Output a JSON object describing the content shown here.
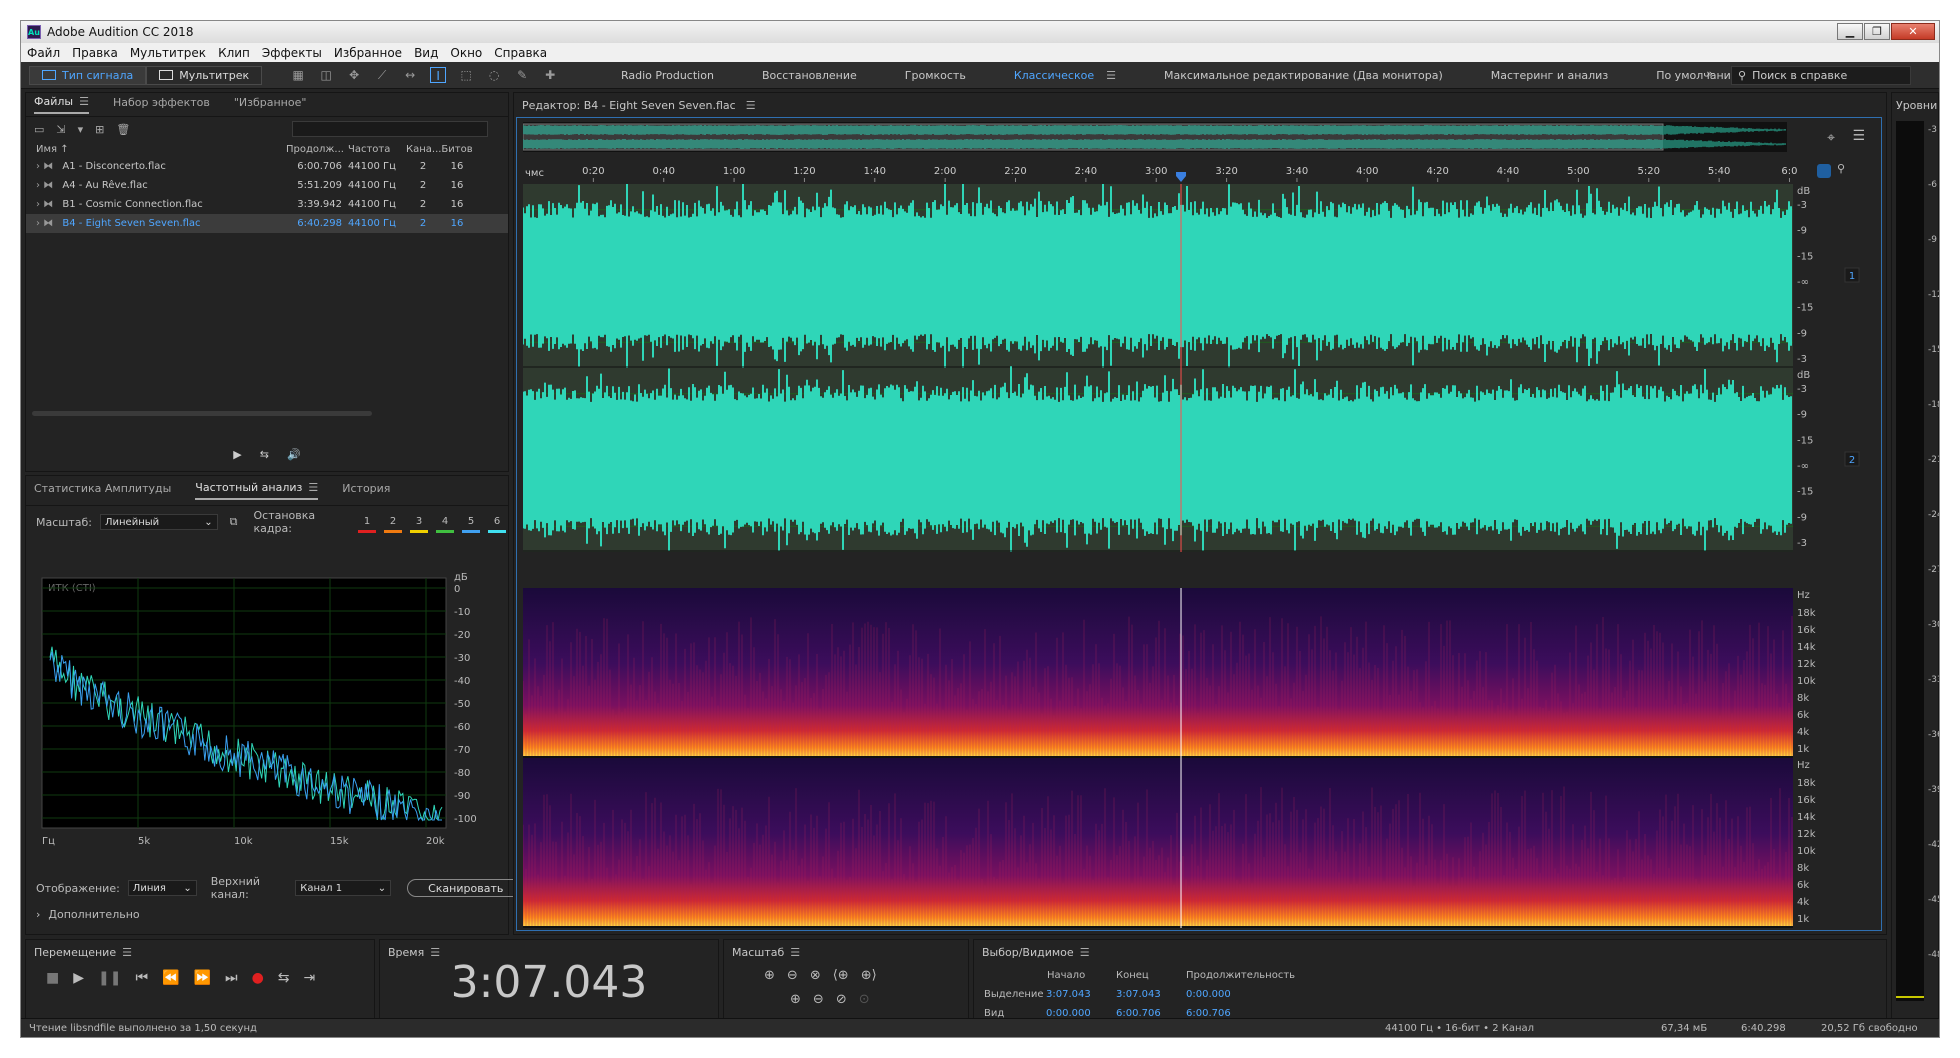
{
  "window": {
    "title": "Adobe Audition CC 2018",
    "app_icon": "Au"
  },
  "menu": [
    "Файл",
    "Правка",
    "Мультитрек",
    "Клип",
    "Эффекты",
    "Избранное",
    "Вид",
    "Окно",
    "Справка"
  ],
  "toolbar": {
    "mode_waveform": "Тип сигнала",
    "mode_multitrack": "Мультитрек",
    "workspaces": [
      "Radio Production",
      "Восстановление",
      "Громкость",
      "Классическое",
      "Максимальное редактирование (Два монитора)",
      "Мастеринг и анализ",
      "По умолчанию"
    ],
    "active_workspace": "Классическое",
    "help_search": "Поиск в справке"
  },
  "files_panel": {
    "tabs": [
      "Файлы",
      "Набор эффектов",
      "\"Избранное\""
    ],
    "columns": [
      "Имя",
      "Продолж...",
      "Частота",
      "Кана...",
      "Битов"
    ],
    "rows": [
      {
        "name": "A1 - Disconcerto.flac",
        "duration": "6:00.706",
        "rate": "44100 Гц",
        "channels": "2",
        "bits": "16",
        "selected": false
      },
      {
        "name": "A4 - Au Rêve.flac",
        "duration": "5:51.209",
        "rate": "44100 Гц",
        "channels": "2",
        "bits": "16",
        "selected": false
      },
      {
        "name": "B1 - Cosmic Connection.flac",
        "duration": "3:39.942",
        "rate": "44100 Гц",
        "channels": "2",
        "bits": "16",
        "selected": false
      },
      {
        "name": "B4 - Eight Seven Seven.flac",
        "duration": "6:40.298",
        "rate": "44100 Гц",
        "channels": "2",
        "bits": "16",
        "selected": true
      }
    ]
  },
  "analysis_panel": {
    "tabs": [
      "Статистика Амплитуды",
      "Частотный анализ",
      "История"
    ],
    "scale_label": "Масштаб:",
    "scale_value": "Линейный",
    "freeze_label": "Остановка кадра:",
    "freeze_slots": [
      "1",
      "2",
      "3",
      "4",
      "5",
      "6"
    ],
    "freeze_colors": [
      "#e02020",
      "#f07a10",
      "#f0d000",
      "#40c040",
      "#40a0f0",
      "#40e0f0"
    ],
    "graph_title": "ИТК (СТI)",
    "db_unit": "дБ",
    "db_ticks": [
      "0",
      "-10",
      "-20",
      "-30",
      "-40",
      "-50",
      "-60",
      "-70",
      "-80",
      "-90",
      "-100"
    ],
    "freq_ticks": [
      "Гц",
      "5k",
      "10k",
      "15k",
      "20k"
    ],
    "display_label": "Отображение:",
    "display_value": "Линия",
    "channel_label": "Верхний канал:",
    "channel_value": "Канал 1",
    "scan_button": "Сканировать",
    "more": "Дополнительно"
  },
  "editor": {
    "title": "Редактор: B4 - Eight Seven Seven.flac",
    "ruler_unit": "чмс",
    "ruler_ticks": [
      "0:20",
      "0:40",
      "1:00",
      "1:20",
      "1:40",
      "2:00",
      "2:20",
      "2:40",
      "3:00",
      "3:20",
      "3:40",
      "4:00",
      "4:20",
      "4:40",
      "5:00",
      "5:20",
      "5:40",
      "6:0"
    ],
    "db_unit": "dB",
    "db_ticks": [
      "-3",
      "-9",
      "-15",
      "-∞",
      "-15",
      "-9",
      "-3"
    ],
    "channel_labels": [
      "1",
      "2"
    ],
    "hz_unit": "Hz",
    "hz_ticks": [
      "18k",
      "16k",
      "14k",
      "12k",
      "10k",
      "8k",
      "6k",
      "4k",
      "1k"
    ],
    "waveform_color": "#2fd6b8",
    "playhead_position_seconds": 187.043
  },
  "levels": {
    "title": "Уровни",
    "ticks": [
      "-3",
      "-6",
      "-9",
      "-12",
      "-15",
      "-18",
      "-21",
      "-24",
      "-27",
      "-30",
      "-33",
      "-36",
      "-39",
      "-42",
      "-45",
      "-48"
    ]
  },
  "transport": {
    "title": "Перемещение"
  },
  "time": {
    "title": "Время",
    "value": "3:07.043"
  },
  "zoom": {
    "title": "Масштаб"
  },
  "selection": {
    "title": "Выбор/Видимое",
    "col_start": "Начало",
    "col_end": "Конец",
    "col_duration": "Продолжительность",
    "row_selection": "Выделение",
    "row_view": "Вид",
    "sel_start": "3:07.043",
    "sel_end": "3:07.043",
    "sel_duration": "0:00.000",
    "view_start": "0:00.000",
    "view_end": "6:00.706",
    "view_duration": "6:00.706"
  },
  "status": {
    "message": "Чтение libsndfile выполнено за 1,50 секунд",
    "format": "44100 Гц • 16-бит • 2 Канал",
    "size": "67,34 мБ",
    "duration": "6:40.298",
    "free": "20,52 Гб свободно"
  }
}
